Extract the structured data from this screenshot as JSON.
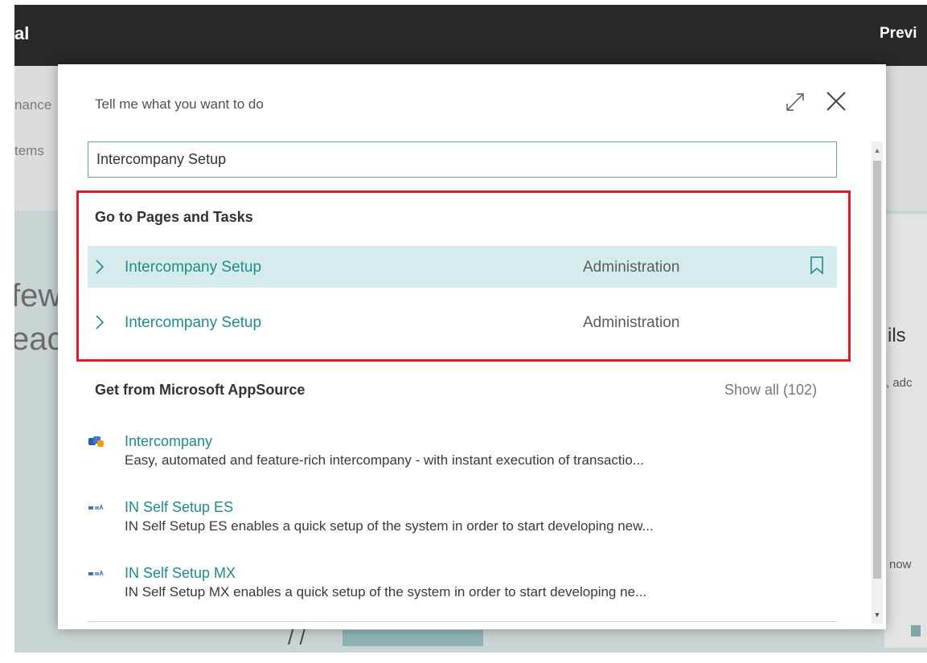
{
  "background": {
    "topbar_left_fragment": "al",
    "topbar_right_fragment": "Previ",
    "nav_fragment_1": "nance",
    "nav_fragment_2": "tems",
    "headline_fragment_1": "few",
    "headline_fragment_2": "eac",
    "side_fragment_1": "ils",
    "side_fragment_2": ", adc",
    "side_fragment_3": "now",
    "bottom_mark": "/ /"
  },
  "dialog": {
    "title": "Tell me what you want to do",
    "search_value": "Intercompany Setup",
    "pages_section": {
      "heading": "Go to Pages and Tasks",
      "results": [
        {
          "name": "Intercompany Setup",
          "category": "Administration",
          "selected": true
        },
        {
          "name": "Intercompany Setup",
          "category": "Administration",
          "selected": false
        }
      ]
    },
    "appsource_section": {
      "heading": "Get from Microsoft AppSource",
      "show_all": "Show all (102)",
      "apps": [
        {
          "name": "Intercompany",
          "description": "Easy, automated and feature-rich intercompany - with instant execution of transactio...",
          "icon": "intercompany-app-icon"
        },
        {
          "name": "IN Self Setup ES",
          "description": "IN Self Setup ES enables a quick setup of the system in order to start developing new...",
          "icon": "in-self-setup-app-icon"
        },
        {
          "name": "IN Self Setup MX",
          "description": "IN Self Setup MX enables a quick setup of the system in order to start developing ne...",
          "icon": "in-self-setup-app-icon"
        }
      ]
    }
  },
  "colors": {
    "accent": "#1e8c8c",
    "highlight_border": "#e21b25",
    "selected_row": "#d6ecec",
    "topbar": "#282828"
  }
}
